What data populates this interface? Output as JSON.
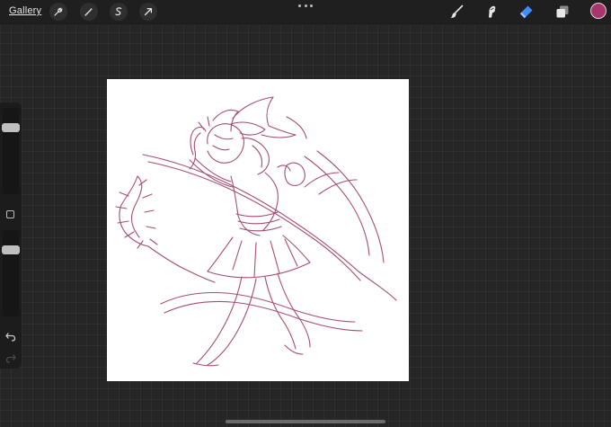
{
  "topbar": {
    "gallery_label": "Gallery",
    "left_tools": [
      "wrench-icon",
      "magic-wand-icon",
      "selection-icon",
      "transform-arrow-icon"
    ],
    "right_tools": [
      "brush-icon",
      "smudge-icon",
      "eraser-icon",
      "layers-icon"
    ],
    "active_tool": "eraser",
    "current_color": "#a8356b",
    "accent_color": "#3f8cff"
  },
  "sidebar": {
    "brush_size_level": 0.2,
    "opacity_level": 0.2,
    "controls": [
      "modify-button",
      "undo-icon",
      "redo-icon"
    ]
  },
  "canvas": {
    "background": "#ffffff",
    "stroke_color": "#9c3a68",
    "content": "sketch-drawing"
  }
}
